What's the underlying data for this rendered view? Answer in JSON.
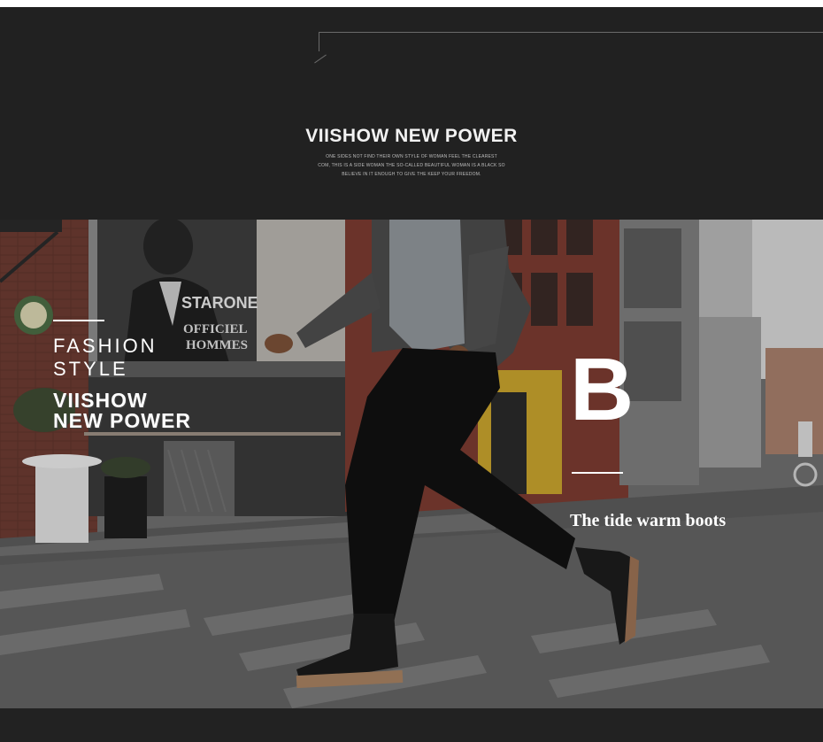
{
  "header": {
    "title": "VIISHOW NEW POWER",
    "subtext_lines": [
      "ONE SIDES NOT FIND THEIR OWN STYLE OF WOMAN FEEL THE CLEAREST",
      "COM, THIS IS A SIDE WOMAN THE SO-CALLED BEAUTIFUL WOMAN IS A BLACK SO",
      "BELIEVE IN IT ENOUGH TO GIVE THE KEEP YOUR FREEDOM."
    ]
  },
  "photo": {
    "fashion": "FASHION",
    "style": "STYLE",
    "brand_line1": "VIISHOW",
    "brand_line2": "NEW POWER",
    "big_letter": "B",
    "tagline": "The tide warm boots",
    "billboard_brand": "STARONE",
    "billboard_text1": "OFFICIEL",
    "billboard_text2": "HOMMES"
  }
}
